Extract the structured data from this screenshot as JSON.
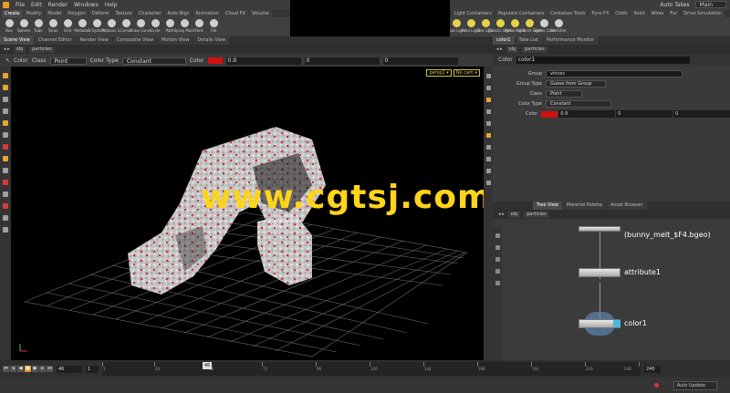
{
  "menu": {
    "items": [
      "File",
      "Edit",
      "Render",
      "Windows",
      "Help"
    ],
    "auto_takes": "Auto Takes",
    "desktop": "Main"
  },
  "shelf": {
    "tabs": [
      "Create",
      "Modify",
      "Model",
      "Polygon",
      "Deform",
      "Texture",
      "Character",
      "Auto Rigs",
      "Animation",
      "Cloud FX",
      "Volume"
    ],
    "tools": [
      "Box",
      "Sphere",
      "Tube",
      "Torus",
      "Grid",
      "Metaball",
      "L-System",
      "Platonic S.",
      "Curve",
      "Draw Curve",
      "Circle",
      "Path",
      "Spray Paint",
      "Font",
      "File"
    ],
    "right_tabs": [
      "Light Containers",
      "Populate Containers",
      "Container Tools",
      "Pyro FX",
      "Cloth",
      "Solid",
      "Wires",
      "Fur",
      "Drive Simulation"
    ],
    "right_tools": [
      "Spot Light",
      "Area Light",
      "Geo Light",
      "Caustic Light",
      "Portal Light",
      "Ambient Light",
      "Stereo Cam",
      "Switcher"
    ]
  },
  "left_pane": {
    "tabs": [
      "Scene View",
      "Channel Editor",
      "Render View",
      "Composite View",
      "Motion View",
      "Details View"
    ],
    "path": [
      "obj",
      "particles"
    ],
    "toolbar": {
      "title": "Color",
      "class_label": "Class",
      "class_value": "Point",
      "color_type_label": "Color Type",
      "color_type_value": "Constant",
      "color_label": "Color",
      "color_swatch": "#d21010",
      "r": "0.9",
      "g": "0",
      "b": "0"
    },
    "camera": {
      "persp": "persp1 ▾",
      "cam": "No cam ▾"
    }
  },
  "watermark": "www.cgtsj.com",
  "params": {
    "tabs": [
      "color1",
      "Take List",
      "Performance Monitor"
    ],
    "path": [
      "obj",
      "particles"
    ],
    "header_type": "Color",
    "node_name": "color1",
    "rows": [
      {
        "label": "Group",
        "value": "vinces"
      },
      {
        "label": "Group Type",
        "value": "Guess from Group"
      },
      {
        "label": "Class",
        "value": "Point"
      },
      {
        "label": "Color Type",
        "value": "Constant"
      }
    ],
    "color": {
      "label": "Color",
      "swatch": "#d21010",
      "r": "0.9",
      "g": "0",
      "b": "0"
    }
  },
  "network": {
    "tabs": [
      "Tree View",
      "Material Palette",
      "Asset Browser"
    ],
    "path": [
      "obj",
      "particles"
    ],
    "nodes": [
      {
        "name": "(bunny_melt_$F4.bgeo)"
      },
      {
        "name": "attribute1"
      },
      {
        "name": "color1"
      }
    ]
  },
  "timeline": {
    "current_frame": "46",
    "start_frame": "1",
    "end_frame": "240",
    "ticks": [
      "1",
      "24",
      "48",
      "72",
      "96",
      "120",
      "144",
      "168",
      "192",
      "216",
      "240"
    ],
    "auto_update": "Auto Update"
  }
}
